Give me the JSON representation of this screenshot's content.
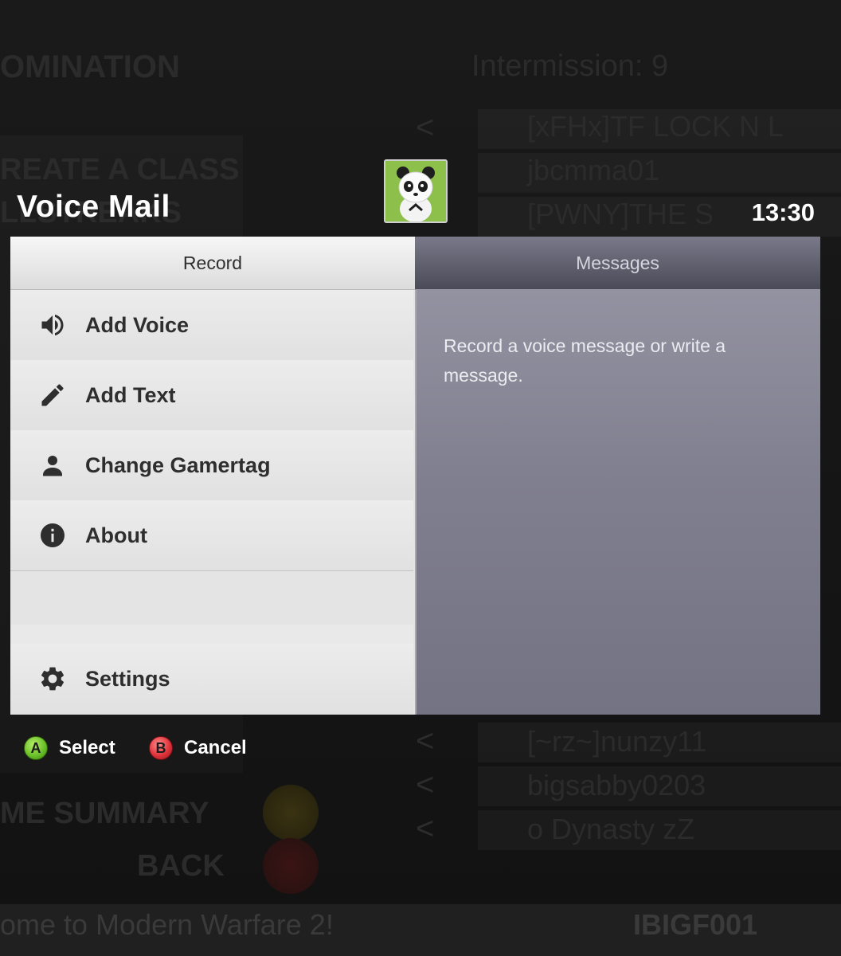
{
  "header": {
    "title": "Voice Mail",
    "clock": "13:30"
  },
  "avatar": {
    "icon": "panda-gamerpic-icon"
  },
  "tabs": [
    {
      "label": "Record",
      "selected": true
    },
    {
      "label": "Messages",
      "selected": false
    }
  ],
  "menu": {
    "items": [
      {
        "label": "Add Voice",
        "icon": "speaker-icon"
      },
      {
        "label": "Add Text",
        "icon": "pencil-icon"
      },
      {
        "label": "Change Gamertag",
        "icon": "person-icon"
      },
      {
        "label": "About",
        "icon": "info-icon"
      }
    ],
    "settings": {
      "label": "Settings",
      "icon": "gear-icon"
    }
  },
  "detail": {
    "text": "Record a voice message or write a message."
  },
  "footer": {
    "select": {
      "button": "A",
      "label": "Select",
      "color": "#6cc12a"
    },
    "cancel": {
      "button": "B",
      "label": "Cancel",
      "color": "#e0333b"
    }
  },
  "background_screen": {
    "heading_left": "OMINATION",
    "heading_right": "Intermission: 9",
    "menu_items": [
      "REATE A CLASS",
      "LLSTREAKS",
      "ME SUMMARY",
      "BACK"
    ],
    "players": [
      "[xFHx]TF LOCK N L",
      "jbcmma01",
      "[PWNY]THE S",
      "[~rz~]nunzy11",
      "bigsabby0203",
      "o Dynasty zZ"
    ],
    "ticker": "ome to Modern Warfare 2!",
    "ticker_right": "IBIGF001"
  }
}
